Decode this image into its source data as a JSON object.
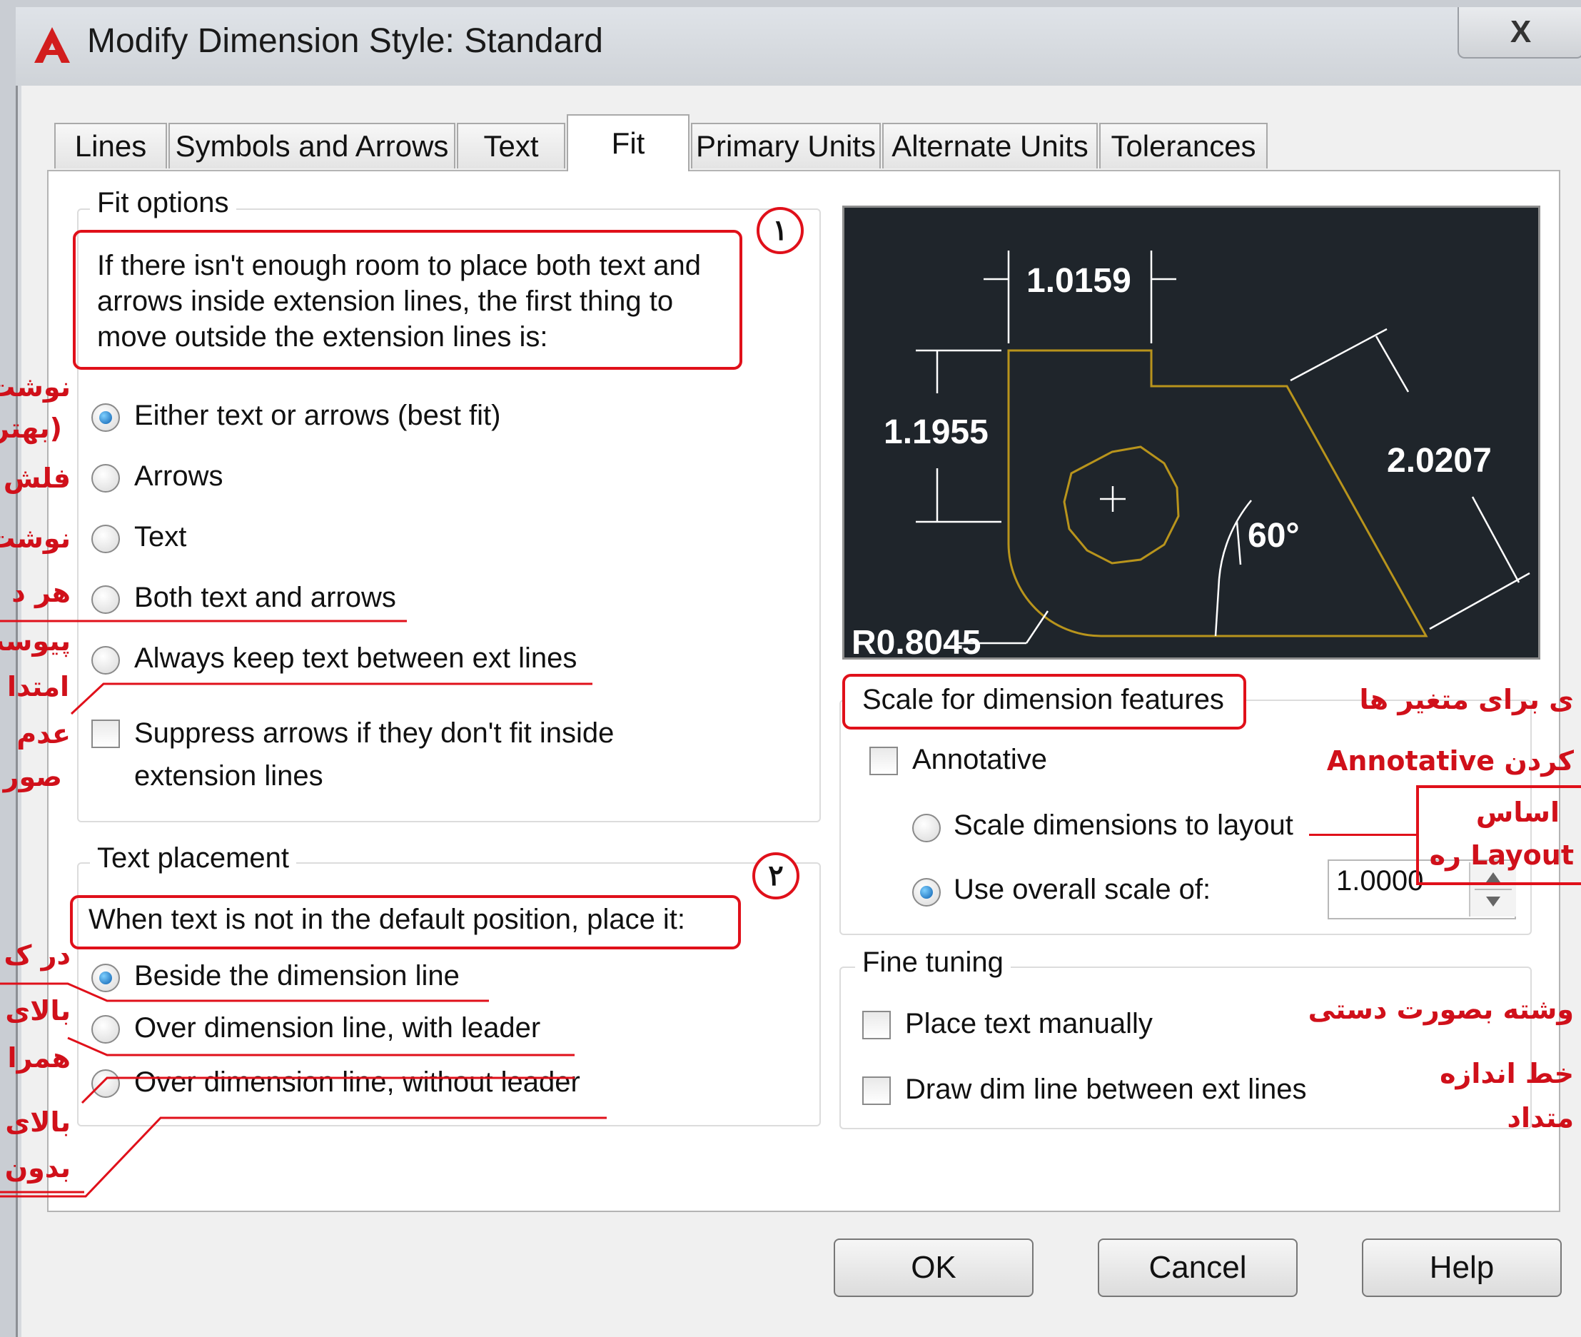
{
  "window": {
    "title": "Modify Dimension Style: Standard",
    "close_glyph": "X"
  },
  "tabs": [
    "Lines",
    "Symbols and Arrows",
    "Text",
    "Fit",
    "Primary Units",
    "Alternate Units",
    "Tolerances"
  ],
  "active_tab": "Fit",
  "fit_options": {
    "legend": "Fit options",
    "description": [
      "If there isn't enough room to place both text and",
      "arrows inside extension lines, the first thing to",
      "move outside the extension lines is:"
    ],
    "radios": [
      "Either text or arrows (best fit)",
      "Arrows",
      "Text",
      "Both text and arrows",
      "Always keep text between ext lines"
    ],
    "selected": "Either text or arrows (best fit)",
    "suppress_label": [
      "Suppress arrows if they don't fit inside",
      "extension lines"
    ]
  },
  "text_placement": {
    "legend": "Text placement",
    "description": "When text is not in the default position, place it:",
    "radios": [
      "Beside the dimension line",
      "Over dimension line, with leader",
      "Over dimension line, without leader"
    ],
    "selected": "Beside the dimension line"
  },
  "preview": {
    "dim_top": "1.0159",
    "dim_left": "1.1955",
    "dim_right": "2.0207",
    "angle": "60°",
    "radius": "R0.8045"
  },
  "scale": {
    "legend": "Scale for dimension features",
    "annotative": "Annotative",
    "scale_to_layout": "Scale dimensions to layout",
    "use_overall": "Use overall scale of:",
    "overall_value": "1.0000"
  },
  "fine_tuning": {
    "legend": "Fine tuning",
    "place_manually": "Place text manually",
    "draw_dim_line": "Draw dim line between ext lines"
  },
  "buttons": {
    "ok": "OK",
    "cancel": "Cancel",
    "help": "Help"
  },
  "annotations": {
    "circle_1": "۱",
    "circle_2": "۲",
    "left": [
      "نوشت",
      "(بهتر",
      "فلش",
      "نوشت",
      "هر د",
      "پیوست",
      "امتدا",
      "عدم",
      "صور",
      "در ک",
      "بالای",
      "همرا",
      "بالای",
      "بدون"
    ],
    "right": {
      "scale_vars": "ی برای متغیر ها",
      "annotative_note": "کردن  Annotative",
      "layout_line1": "اساس",
      "layout_line2": "Layout  ره",
      "manual_note": "وشته بصورت دستی",
      "draw_line1": "خط اندازه",
      "draw_line2": "متداد"
    }
  },
  "colors": {
    "annotation_red": "#e0101a",
    "preview_bg": "#1f252b",
    "preview_geometry": "#b8941c",
    "preview_text": "#ffffff"
  }
}
